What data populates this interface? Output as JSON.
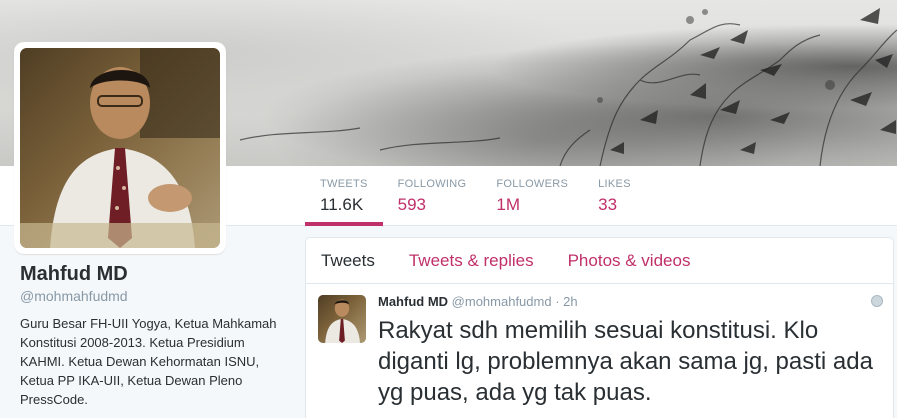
{
  "header": {
    "image": "header-sketch-image"
  },
  "profile": {
    "name": "Mahfud MD",
    "handle": "@mohmahfudmd",
    "bio": "Guru Besar FH-UII Yogya, Ketua Mahkamah Konstitusi 2008-2013. Ketua Presidium KAHMI. Ketua Dewan Kehormatan ISNU, Ketua PP IKA-UII, Ketua Dewan Pleno PressCode."
  },
  "stats": [
    {
      "label": "TWEETS",
      "value": "11.6K"
    },
    {
      "label": "FOLLOWING",
      "value": "593"
    },
    {
      "label": "FOLLOWERS",
      "value": "1M"
    },
    {
      "label": "LIKES",
      "value": "33"
    }
  ],
  "timeline": {
    "tabs": [
      {
        "label": "Tweets"
      },
      {
        "label": "Tweets & replies"
      },
      {
        "label": "Photos & videos"
      }
    ],
    "tweet": {
      "name": "Mahfud MD",
      "handle": "@mohmahfudmd",
      "separator": "·",
      "time": "2h",
      "text": "Rakyat sdh memilih sesuai konstitusi. Klo diganti lg, problemnya akan sama jg, pasti ada yg puas, ada yg tak puas."
    }
  },
  "colors": {
    "accent": "#c0306a",
    "text": "#292f33",
    "muted": "#8899a6",
    "background": "#f5f8fa"
  }
}
